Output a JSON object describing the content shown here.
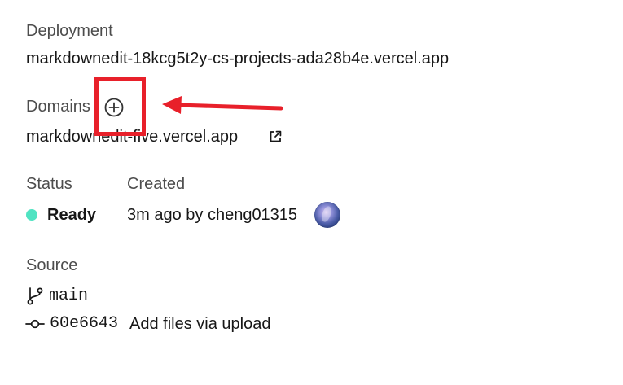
{
  "deployment": {
    "label": "Deployment",
    "url": "markdownedit-18kcg5t2y-cs-projects-ada28b4e.vercel.app"
  },
  "domains": {
    "label": "Domains",
    "items": [
      "markdownedit-five.vercel.app"
    ],
    "add_icon": "plus-circle-icon",
    "external_link_icon": "external-link-icon"
  },
  "status": {
    "label": "Status",
    "value": "Ready",
    "color": "#50e3c2"
  },
  "created": {
    "label": "Created",
    "value": "3m ago by cheng01315"
  },
  "source": {
    "label": "Source",
    "branch": "main",
    "branch_icon": "git-branch-icon",
    "commit_hash": "60e6643",
    "commit_message": "Add files via upload",
    "commit_icon": "git-commit-icon"
  },
  "annotation": {
    "color": "#e8202a"
  }
}
